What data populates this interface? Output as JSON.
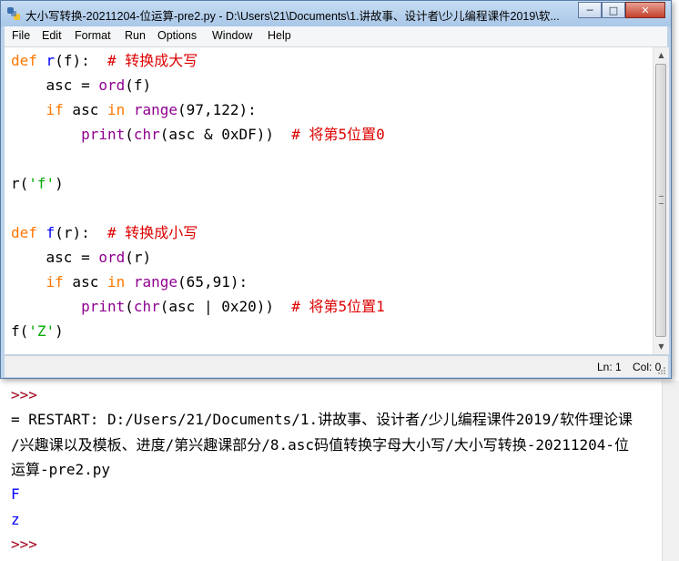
{
  "window": {
    "title": "大小写转换-20211204-位运算-pre2.py - D:\\Users\\21\\Documents\\1.讲故事、设计者\\少儿编程课件2019\\软..."
  },
  "menu": [
    "File",
    "Edit",
    "Format",
    "Run",
    "Options",
    "Window",
    "Help"
  ],
  "editor": {
    "lines": [
      {
        "segs": [
          {
            "t": "def",
            "c": "kw"
          },
          {
            "t": " "
          },
          {
            "t": "r",
            "c": "def"
          },
          {
            "t": "(f):  "
          },
          {
            "t": "# 转换成大写",
            "c": "cmt"
          }
        ]
      },
      {
        "segs": [
          {
            "t": "    asc = "
          },
          {
            "t": "ord",
            "c": "bi"
          },
          {
            "t": "(f)"
          }
        ]
      },
      {
        "segs": [
          {
            "t": "    "
          },
          {
            "t": "if",
            "c": "kw"
          },
          {
            "t": " asc "
          },
          {
            "t": "in",
            "c": "kw"
          },
          {
            "t": " "
          },
          {
            "t": "range",
            "c": "bi"
          },
          {
            "t": "(97,122):"
          }
        ]
      },
      {
        "segs": [
          {
            "t": "        "
          },
          {
            "t": "print",
            "c": "bi"
          },
          {
            "t": "("
          },
          {
            "t": "chr",
            "c": "bi"
          },
          {
            "t": "(asc & 0xDF))  "
          },
          {
            "t": "# 将第5位置0",
            "c": "cmt"
          }
        ]
      },
      {
        "segs": []
      },
      {
        "segs": [
          {
            "t": "r("
          },
          {
            "t": "'f'",
            "c": "str"
          },
          {
            "t": ")"
          }
        ]
      },
      {
        "segs": []
      },
      {
        "segs": [
          {
            "t": "def",
            "c": "kw"
          },
          {
            "t": " "
          },
          {
            "t": "f",
            "c": "def"
          },
          {
            "t": "(r):  "
          },
          {
            "t": "# 转换成小写",
            "c": "cmt"
          }
        ]
      },
      {
        "segs": [
          {
            "t": "    asc = "
          },
          {
            "t": "ord",
            "c": "bi"
          },
          {
            "t": "(r)"
          }
        ]
      },
      {
        "segs": [
          {
            "t": "    "
          },
          {
            "t": "if",
            "c": "kw"
          },
          {
            "t": " asc "
          },
          {
            "t": "in",
            "c": "kw"
          },
          {
            "t": " "
          },
          {
            "t": "range",
            "c": "bi"
          },
          {
            "t": "(65,91):"
          }
        ]
      },
      {
        "segs": [
          {
            "t": "        "
          },
          {
            "t": "print",
            "c": "bi"
          },
          {
            "t": "("
          },
          {
            "t": "chr",
            "c": "bi"
          },
          {
            "t": "(asc | 0x20))  "
          },
          {
            "t": "# 将第5位置1",
            "c": "cmt"
          }
        ]
      },
      {
        "segs": [
          {
            "t": "f("
          },
          {
            "t": "'Z'",
            "c": "str"
          },
          {
            "t": ")"
          }
        ]
      }
    ]
  },
  "status": {
    "ln": "Ln: 1",
    "col": "Col: 0"
  },
  "shell": {
    "lines": [
      {
        "text": ">>>",
        "kind": "prompt"
      },
      {
        "text": "= RESTART: D:/Users/21/Documents/1.讲故事、设计者/少儿编程课件2019/软件理论课",
        "kind": "info"
      },
      {
        "text": "/兴趣课以及模板、进度/第兴趣课部分/8.asc码值转换字母大小写/大小写转换-20211204-位",
        "kind": "info"
      },
      {
        "text": "运算-pre2.py",
        "kind": "info"
      },
      {
        "text": "F",
        "kind": "out"
      },
      {
        "text": "z",
        "kind": "out"
      },
      {
        "text": ">>>",
        "kind": "prompt"
      }
    ]
  }
}
